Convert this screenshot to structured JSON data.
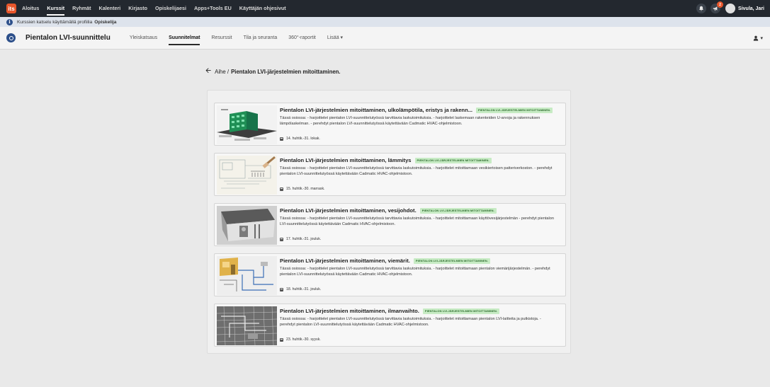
{
  "topbar": {
    "logo": "its",
    "nav": [
      "Aloitus",
      "Kurssit",
      "Ryhmät",
      "Kalenteri",
      "Kirjasto",
      "Opiskelijaesi",
      "Apps+Tools EU",
      "Käyttäjän ohjesivut"
    ],
    "active_nav": "Kurssit",
    "notification_badge": "2",
    "user_name": "Sivula, Jari",
    "icons": [
      "bell-icon",
      "megaphone-icon",
      "avatar"
    ]
  },
  "infobar": {
    "text": "Kurssien katselu käyttämällä profiilia",
    "profile": "Opiskelija"
  },
  "course": {
    "title": "Pientalon LVI-suunnittelu",
    "tabs": [
      "Yleiskatsaus",
      "Suunnitelmat",
      "Resurssit",
      "Tila ja seuranta",
      "360°-raportit",
      "Lisää ▾"
    ],
    "active_tab": "Suunnitelmat",
    "user_menu_caret": "▾"
  },
  "breadcrumb": {
    "prefix": "Aihe /",
    "current": "Pientalon LVI-järjestelmien mitoittaminen."
  },
  "cards": [
    {
      "title": "Pientalon LVI-järjestelmien mitoittaminen, ulkolämpötila, eristys ja rakenn...",
      "tag": "PIENTALON LVI-JÄRJESTELMIEN MITOITTAMINEN.",
      "desc": "Tässä osiossa: - harjoittelet pientalon LVI-suunnittelutyössä tarvittavia laskutoimituksia. - harjoittelet laskemaan rakenteiden U-arvoja ja rakennuksen lämpölaskelman. - perehdyt pientalon LVI-suunnittelutyössä käytettävään Cadmatic HVAC-ohjelmistoon.",
      "date": "14. huhtik.-31. lokak."
    },
    {
      "title": "Pientalon LVI-järjestelmien mitoittaminen, lämmitys",
      "tag": "PIENTALON LVI-JÄRJESTELMIEN MITOITTAMINEN.",
      "desc": "Tässä osiossa: - harjoittelet pientalon LVI-suunnittelutyössä tarvittavia laskutoimituksia. - harjoittelet mitoittamaan vesikiertoisen patteriverkoston. - perehdyt pientalon LVI-suunnittelutyössä käytettävään Cadmatic HVAC-ohjelmistoon.",
      "date": "15. huhtik.-30. marrask."
    },
    {
      "title": "Pientalon LVI-järjestelmien mitoittaminen, vesijohdot.",
      "tag": "PIENTALON LVI-JÄRJESTELMIEN MITOITTAMINEN.",
      "desc": "Tässä osiossa: - harjoittelet pientalon LVI-suunnittelutyössä tarvittavia laskutoimituksia. - harjoittelet mitoittamaan käyttövesijärjestelmän - perehdyt pientalon LVI-suunnittelutyössä käytettävään Cadmatic HVAC-ohjelmistoon.",
      "date": "17. huhtik.-31. jouluk."
    },
    {
      "title": "Pientalon LVI-järjestelmien mitoittaminen, viemärit.",
      "tag": "PIENTALON LVI-JÄRJESTELMIEN MITOITTAMINEN.",
      "desc": "Tässä osiossa: - harjoittelet pientalon LVI-suunnittelutyössä tarvittavia laskutoimituksia. - harjoittelet mitoittamaan pientalon viemärijärjestelmän. - perehdyt pientalon LVI-suunnittelutyössä käytettävään Cadmatic HVAC-ohjelmistoon.",
      "date": "18. huhtik.-31. jouluk."
    },
    {
      "title": "Pientalon LVI-järjestelmien mitoittaminen, ilmanvaihto.",
      "tag": "PIENTALON LVI-JÄRJESTELMIEN MITOITTAMINEN.",
      "desc": "Tässä osiossa: - harjoittelet pientalon LVI-suunnittelutyössä tarvittavia laskutoimituksia. - harjoittelet mitoittamaan pientalon LVI-laitteita ja putkistoja. - perehdyt pientalon LVI-suunnittelutyössä käytettävään Cadmatic HVAC-ohjelmistoon.",
      "date": "23. huhtik.-30. syysk."
    }
  ],
  "colors": {
    "topbar": "#23282f",
    "accent": "#e8562b",
    "tag_bg": "#c7ebc4",
    "tag_text": "#2d6b2e",
    "info_bg": "#dde3ec"
  }
}
